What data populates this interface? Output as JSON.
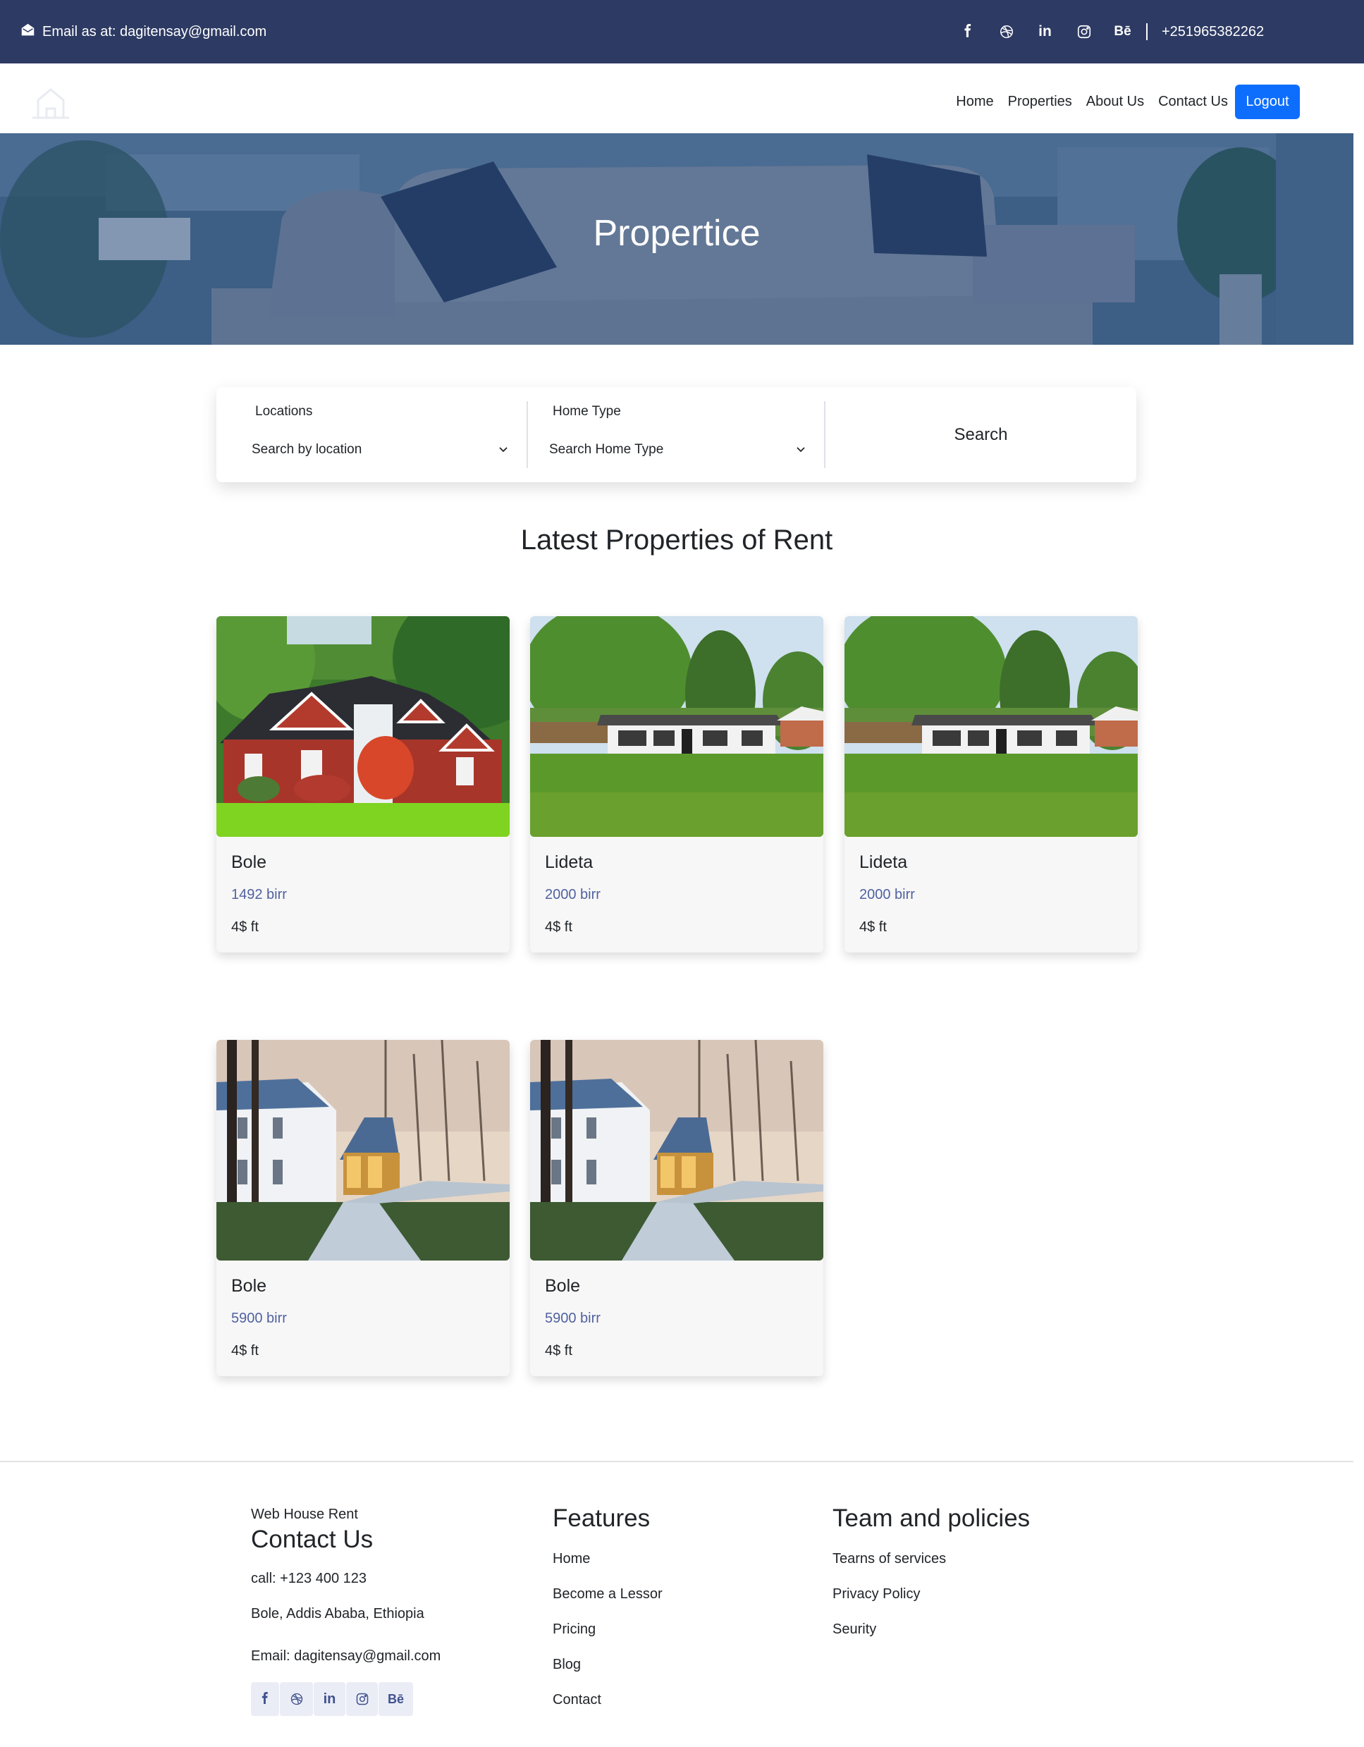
{
  "topbar": {
    "email_text": "Email as at: dagitensay@gmail.com",
    "email_icon": "envelope-open-icon",
    "social": [
      {
        "name": "facebook",
        "icon": "facebook-icon"
      },
      {
        "name": "dribbble",
        "icon": "dribbble-icon"
      },
      {
        "name": "linkedin",
        "icon": "linkedin-icon",
        "glyph": "in"
      },
      {
        "name": "instagram",
        "icon": "instagram-icon"
      },
      {
        "name": "behance",
        "icon": "behance-icon",
        "glyph": "Bē"
      }
    ],
    "phone": "+251965382262"
  },
  "navbar": {
    "logo_icon": "house-icon",
    "links": [
      "Home",
      "Properties",
      "About Us",
      "Contact Us"
    ],
    "logout_label": "Logout"
  },
  "hero": {
    "title": "Propertice"
  },
  "search": {
    "location_label": "Locations",
    "location_value": "Search by location",
    "hometype_label": "Home Type",
    "hometype_value": "Search Home Type",
    "button_label": "Search"
  },
  "listing": {
    "title": "Latest Properties of Rent",
    "cards": [
      {
        "location": "Bole",
        "price": "1492 birr",
        "size": "4$ ft",
        "image": "brick-house-photo"
      },
      {
        "location": "Lideta",
        "price": "2000 birr",
        "size": "4$ ft",
        "image": "white-bungalow-photo"
      },
      {
        "location": "Lideta",
        "price": "2000 birr",
        "size": "4$ ft",
        "image": "white-bungalow-photo"
      },
      {
        "location": "Bole",
        "price": "5900 birr",
        "size": "4$ ft",
        "image": "manor-house-photo"
      },
      {
        "location": "Bole",
        "price": "5900 birr",
        "size": "4$ ft",
        "image": "manor-house-photo"
      }
    ]
  },
  "footer": {
    "brand": "Web House Rent",
    "contact_title": "Contact Us",
    "call": "call: +123 400 123",
    "address": "Bole, Addis Ababa, Ethiopia",
    "email": "Email: dagitensay@gmail.com",
    "features_title": "Features",
    "features": [
      "Home",
      "Become a Lessor",
      "Pricing",
      "Blog",
      "Contact"
    ],
    "policies_title": "Team and policies",
    "policies": [
      "Tearns of services",
      "Privacy Policy",
      "Seurity"
    ],
    "social": [
      {
        "name": "facebook",
        "icon": "facebook-icon"
      },
      {
        "name": "dribbble",
        "icon": "dribbble-icon"
      },
      {
        "name": "linkedin",
        "icon": "linkedin-icon",
        "glyph": "in"
      },
      {
        "name": "instagram",
        "icon": "instagram-icon"
      },
      {
        "name": "behance",
        "icon": "behance-icon",
        "glyph": "Bē"
      }
    ]
  },
  "colors": {
    "topbar_bg": "#2d3a63",
    "primary_button": "#0d6efd",
    "price_text": "#5062a0",
    "card_bg": "#f7f7f7",
    "footer_social_bg": "#eaedf5",
    "footer_social_icon": "#3f5190"
  }
}
